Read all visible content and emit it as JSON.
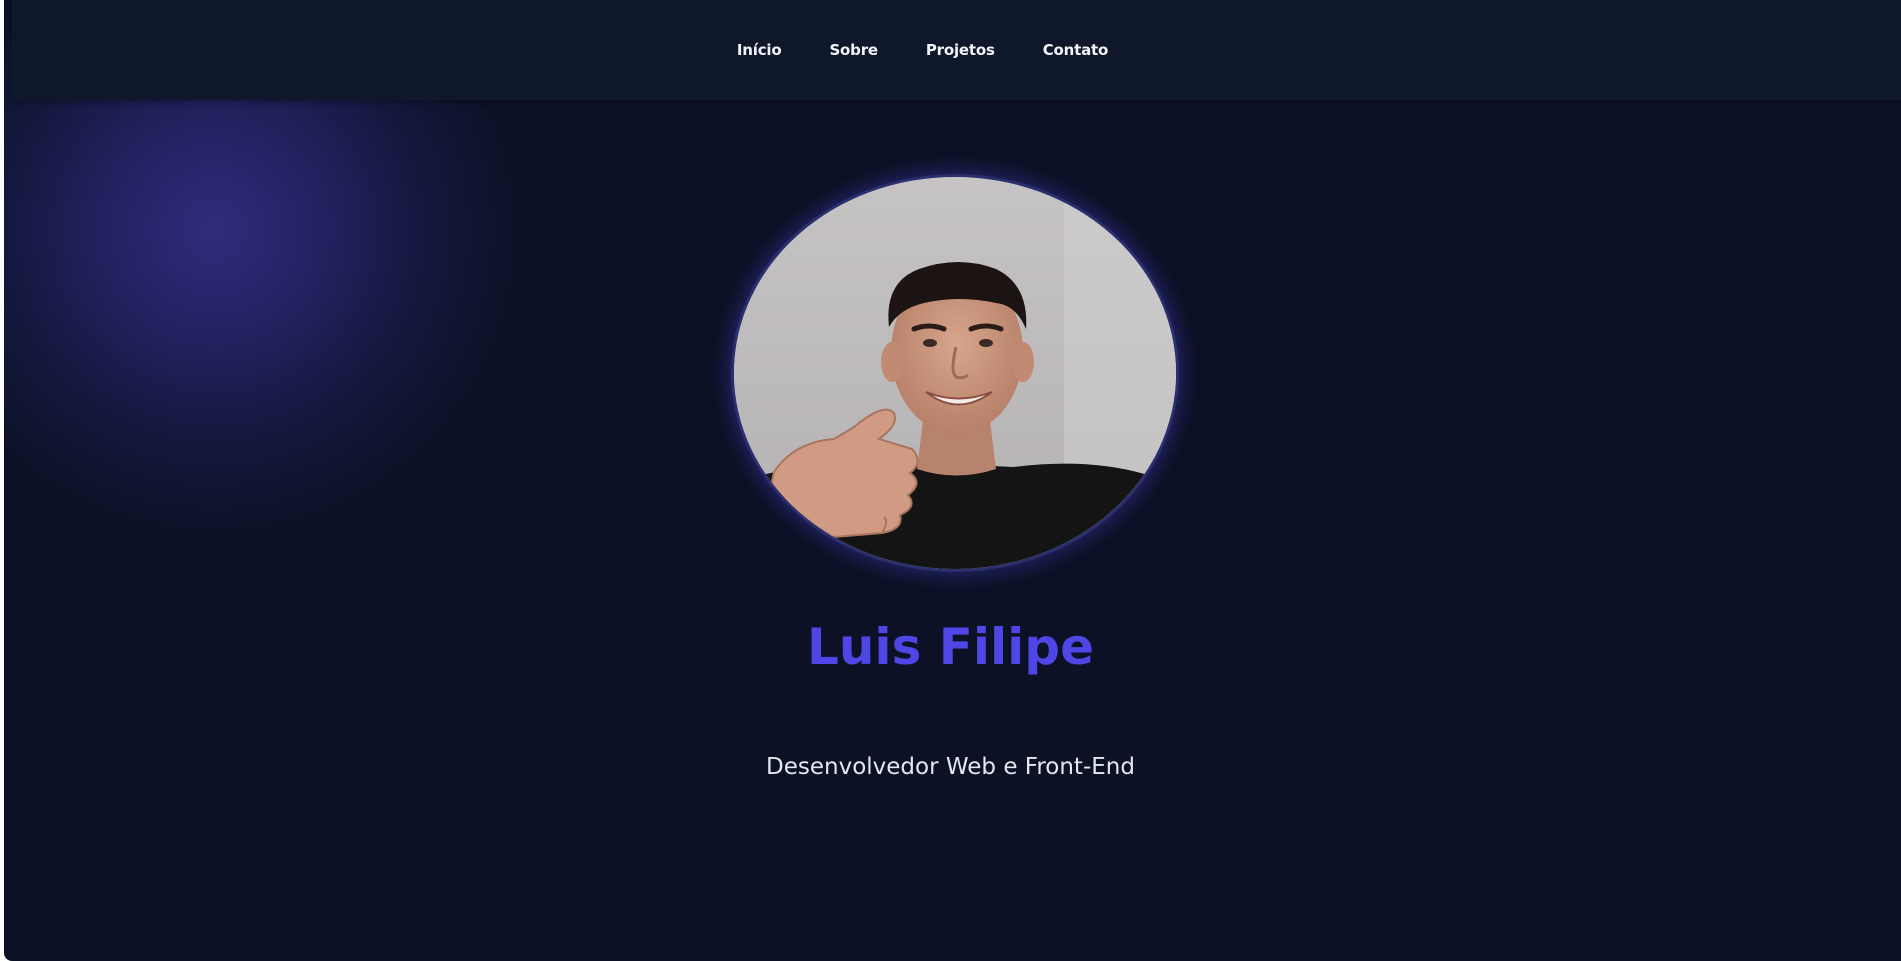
{
  "nav": {
    "items": [
      {
        "label": "Início"
      },
      {
        "label": "Sobre"
      },
      {
        "label": "Projetos"
      },
      {
        "label": "Contato"
      }
    ]
  },
  "hero": {
    "name": "Luis Filipe",
    "subtitle": "Desenvolvedor Web e Front-End"
  },
  "colors": {
    "background": "#0c1125",
    "navbar": "#0f172a",
    "accent": "#4f46e5",
    "nav_text": "#f1f5f9",
    "subtitle_text": "#e2e8f0"
  }
}
